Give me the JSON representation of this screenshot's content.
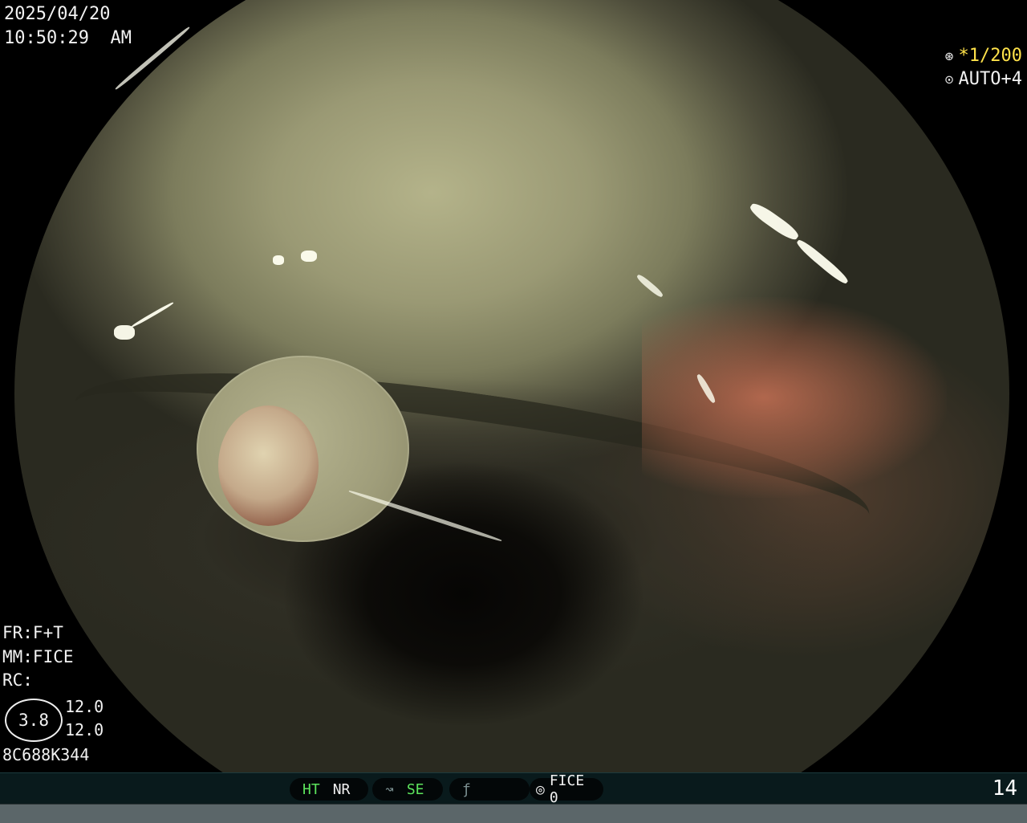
{
  "header": {
    "date": "2025/04/20",
    "time": "10:50:29  AM",
    "shutter_icon": "aperture-icon",
    "shutter_value": "*1/200",
    "auto_icon": "iris-icon",
    "auto_value": "AUTO+4"
  },
  "settings": {
    "fr": "FR:F+T",
    "mm": "MM:FICE",
    "rc": "RC:",
    "circle_value": "3.8",
    "value_top": "12.0",
    "value_bottom": "12.0",
    "serial": "8C688K344"
  },
  "status_bar": {
    "ht": "HT",
    "nr": "NR",
    "enhance_icon": "enhance-curve-icon",
    "se": "SE",
    "script_icon": "italic-f-icon",
    "script_text": "",
    "fice_icon": "fice-mode-icon",
    "fice_label": "FICE 0",
    "page_number": "14"
  },
  "colors": {
    "accent_green": "#5ce35c",
    "accent_yellow": "#ffe24a",
    "status_bar_bg": "#091a1c"
  }
}
